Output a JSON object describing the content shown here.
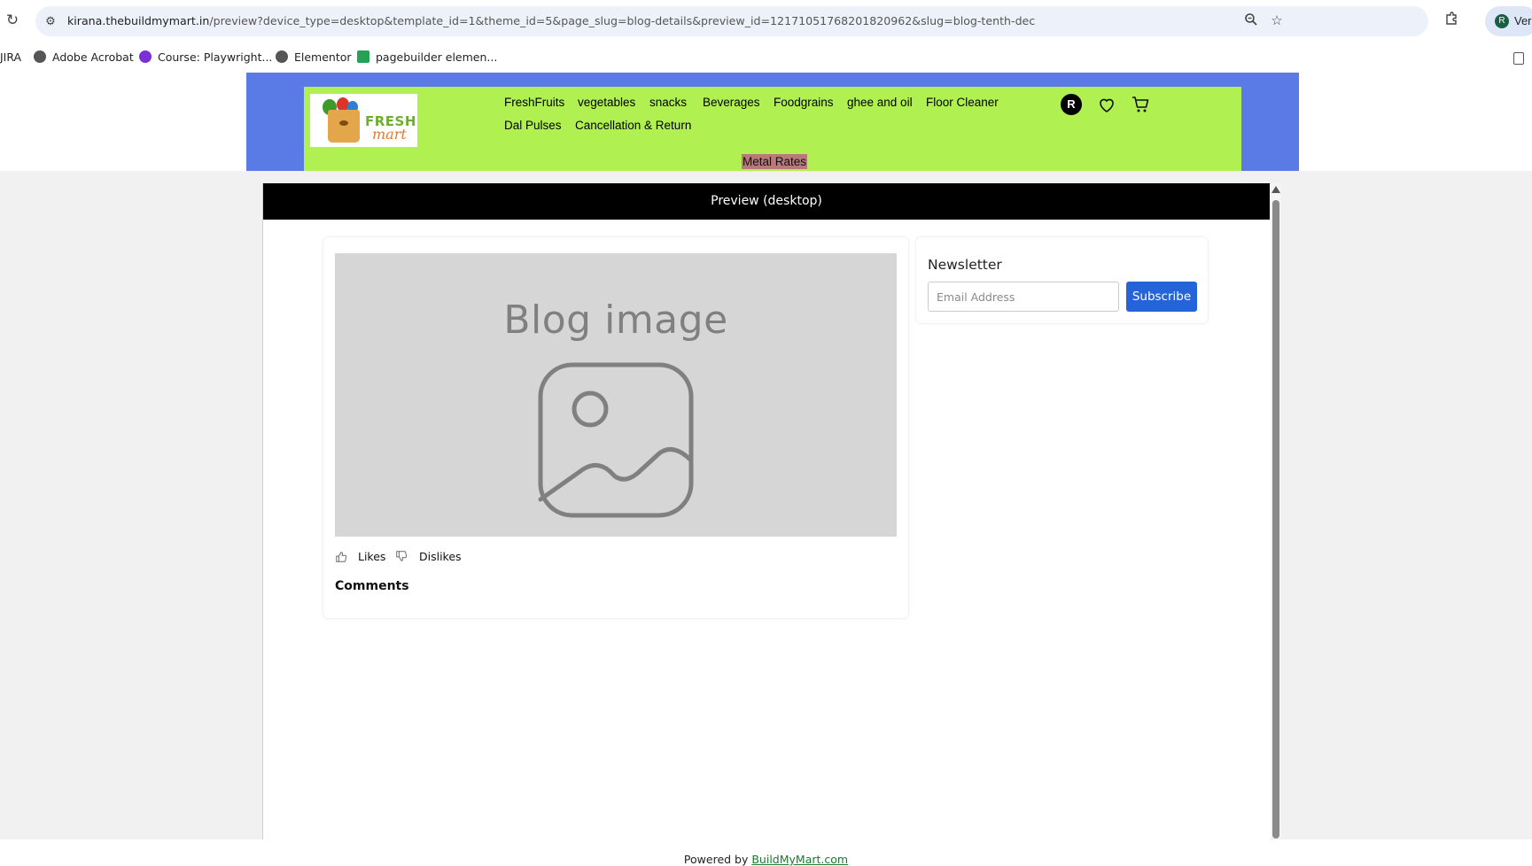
{
  "browser": {
    "url_host": "kirana.thebuildmymart.in",
    "url_path": "/preview?device_type=desktop&template_id=1&theme_id=5&page_slug=blog-details&preview_id=1217105176820182096 2&slug=blog-tenth-dec",
    "profile_label": "Ver",
    "profile_initial": "R",
    "bookmarks": [
      {
        "label": "JIRA"
      },
      {
        "label": "Adobe Acrobat"
      },
      {
        "label": "Course: Playwright..."
      },
      {
        "label": "Elementor"
      },
      {
        "label": "pagebuilder elemen..."
      }
    ]
  },
  "header": {
    "logo_fresh": "FRESH",
    "logo_mart": "mart",
    "nav": [
      {
        "label": "FreshFruits"
      },
      {
        "label": "vegetables"
      },
      {
        "label": "snacks"
      },
      {
        "label": "Beverages"
      },
      {
        "label": "Foodgrains"
      },
      {
        "label": "ghee and oil"
      },
      {
        "label": "Floor Cleaner"
      },
      {
        "label": "Dal Pulses"
      },
      {
        "label": "Cancellation & Return"
      }
    ],
    "metal_rates": "Metal Rates",
    "user_initial": "R"
  },
  "preview": {
    "title": "Preview (desktop)"
  },
  "blog": {
    "image_text": "Blog image",
    "likes_label": "Likes",
    "dislikes_label": "Dislikes",
    "comments_label": "Comments"
  },
  "newsletter": {
    "title": "Newsletter",
    "email_placeholder": "Email Address",
    "subscribe_label": "Subscribe"
  },
  "footer": {
    "powered_by": "Powered by",
    "link_text": "BuildMyMart.com"
  },
  "colors": {
    "header_blue": "#5a7be6",
    "header_green": "#b0f050",
    "subscribe_blue": "#2563d9",
    "metal_rates_bg": "#b9797a"
  }
}
